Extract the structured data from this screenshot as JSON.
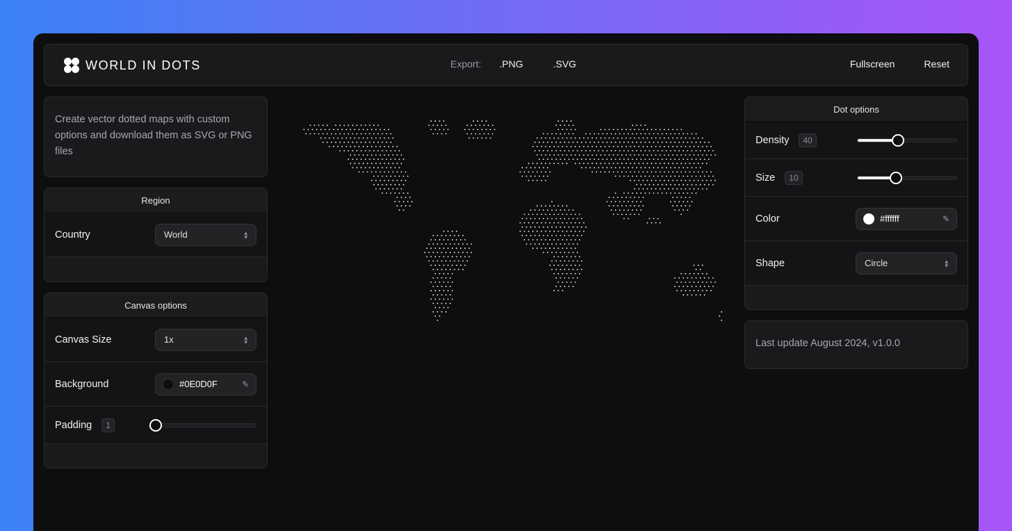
{
  "header": {
    "title": "WORLD IN DOTS",
    "export_label": "Export:",
    "export_png": ".PNG",
    "export_svg": ".SVG",
    "fullscreen": "Fullscreen",
    "reset": "Reset"
  },
  "intro": {
    "text": "Create vector dotted maps with custom options and download them as SVG or PNG files"
  },
  "region": {
    "title": "Region",
    "country_label": "Country",
    "country_value": "World"
  },
  "canvas": {
    "title": "Canvas options",
    "size_label": "Canvas Size",
    "size_value": "1x",
    "background_label": "Background",
    "background_value": "#0E0D0F",
    "background_color": "#0e0d0f",
    "padding_label": "Padding",
    "padding_value": "1",
    "padding_fraction": 0.0
  },
  "dots": {
    "title": "Dot options",
    "density_label": "Density",
    "density_value": "40",
    "density_fraction": 0.4,
    "size_label": "Size",
    "size_value": "10",
    "size_fraction": 0.38,
    "color_label": "Color",
    "color_value": "#ffffff",
    "color_color": "#ffffff",
    "shape_label": "Shape",
    "shape_value": "Circle"
  },
  "footer": {
    "update_text": "Last update August 2024, v1.0.0"
  },
  "icons": {
    "logo": "four-dots-logo-icon",
    "chevron": "chevron-up-down-icon",
    "pencil": "pencil-icon"
  }
}
